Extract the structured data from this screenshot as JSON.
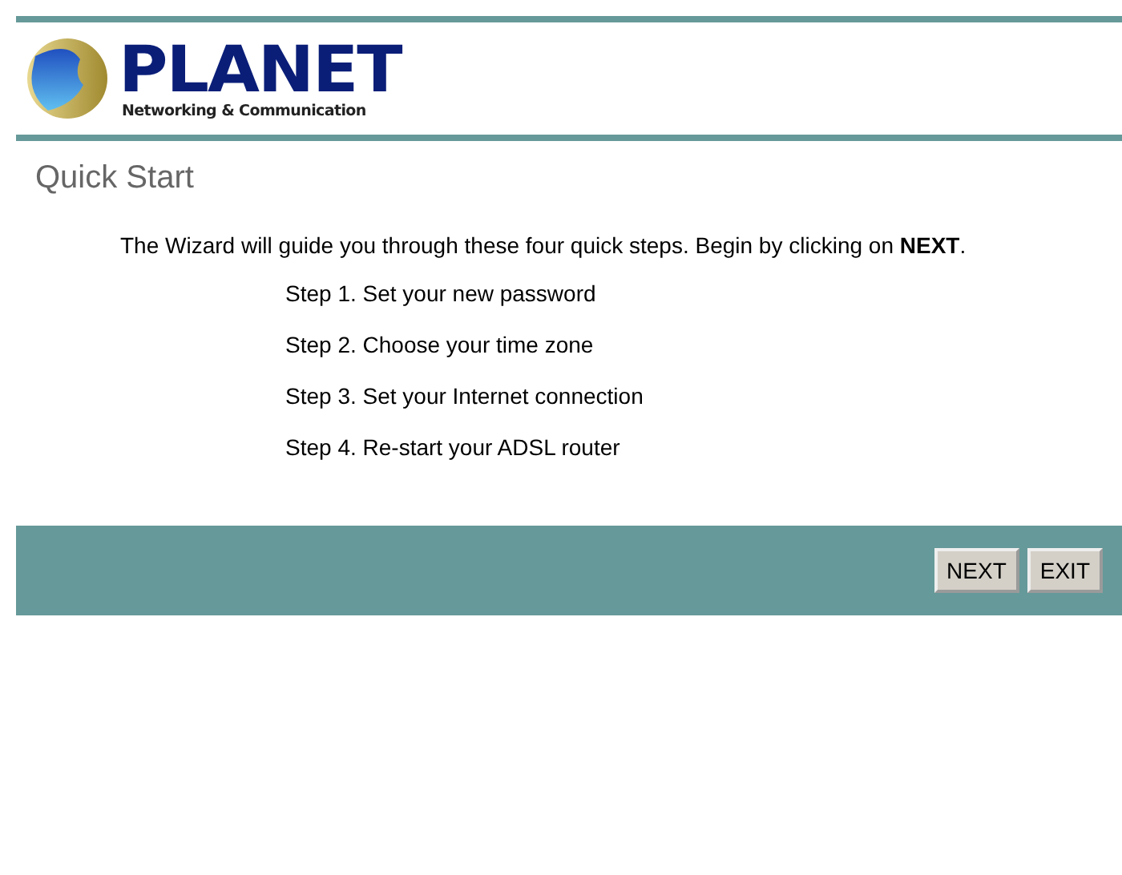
{
  "logo": {
    "name": "PLANET",
    "tagline": "Networking & Communication"
  },
  "title": "Quick Start",
  "intro": "The Wizard will guide you through these four quick steps. Begin by clicking on **NEXT**.",
  "steps": [
    "Step 1. Set your new password",
    "Step 2. Choose your time zone",
    "Step 3. Set your Internet connection",
    "Step 4. Re-start your ADSL router"
  ],
  "buttons": [
    "NEXT",
    "EXIT"
  ]
}
